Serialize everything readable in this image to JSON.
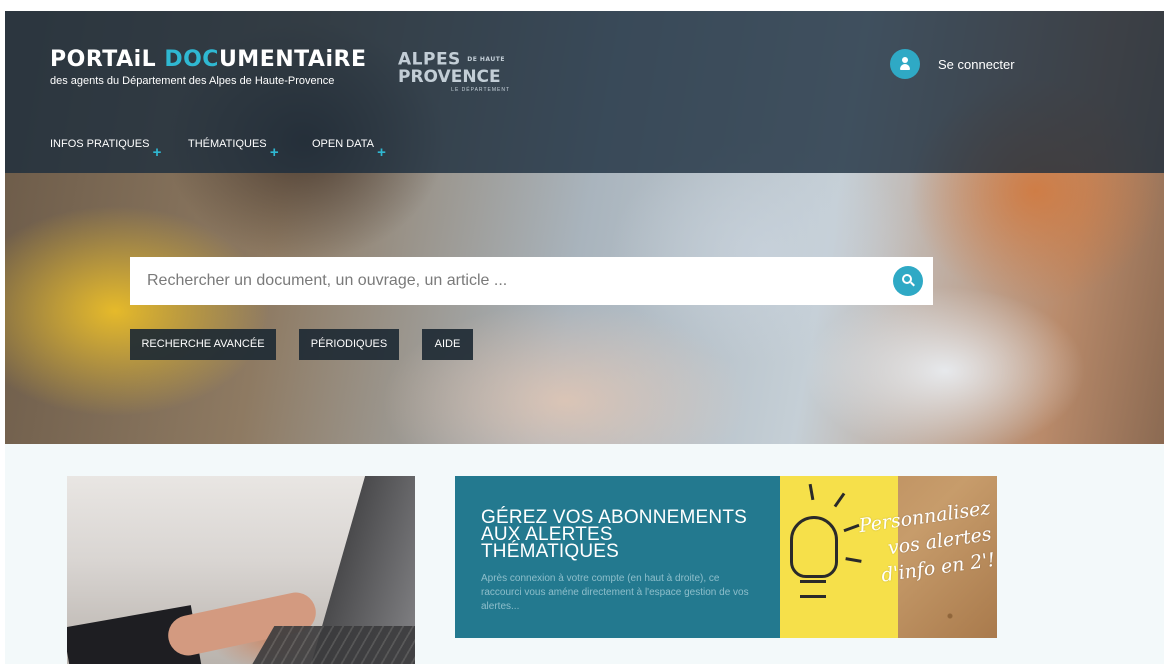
{
  "header": {
    "brand_title_part1": "PORTAiL ",
    "brand_title_accent": "DOC",
    "brand_title_part2": "UMENTAiRE",
    "brand_subtitle": "des agents du Département des Alpes de Haute-Provence",
    "dept_logo": {
      "line1": "ALPES",
      "line1_small": "DE HAUTE",
      "line2": "PROVENCE",
      "line3": "LE DÉPARTEMENT"
    },
    "login_label": "Se connecter",
    "login_icon": "user-icon"
  },
  "nav": {
    "items": [
      {
        "label": "INFOS PRATIQUES",
        "icon": "plus-icon"
      },
      {
        "label": "THÉMATIQUES",
        "icon": "plus-icon"
      },
      {
        "label": "OPEN DATA",
        "icon": "plus-icon"
      }
    ]
  },
  "search": {
    "placeholder": "Rechercher un document, un ouvrage, un article ...",
    "value": "",
    "button_icon": "search-icon"
  },
  "quick_links": [
    {
      "label": "RECHERCHE AVANCÉE"
    },
    {
      "label": "PÉRIODIQUES"
    },
    {
      "label": "AIDE"
    }
  ],
  "promo": {
    "title_line1": "GÉREZ VOS ABONNEMENTS",
    "title_line2": "AUX ALERTES THÉMATIQUES",
    "text": "Après connexion à votre compte (en haut à droite), ce raccourci vous améne directement à l'espace gestion de vos alertes...",
    "image_text": "Personnalisez vos alertes d'info en 2'!"
  },
  "colors": {
    "accent": "#2fb8d2",
    "header_overlay": "#1a2c3c",
    "promo_bg": "#23798f",
    "content_bg": "#f3f9fa"
  }
}
